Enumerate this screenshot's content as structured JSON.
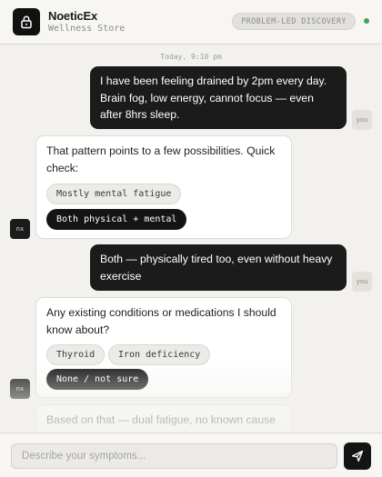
{
  "header": {
    "brand": "NoeticEx",
    "subtitle": "Wellness Store",
    "badge": "PROBLEM-LED DISCOVERY",
    "status_color": "#3fa45b"
  },
  "timestamp": "Today, 9:10 pm",
  "messages": [
    {
      "from": "you",
      "avatar": "you",
      "text": "I have been feeling drained by 2pm every day. Brain fog, low energy, cannot focus — even after 8hrs sleep."
    },
    {
      "from": "bot",
      "avatar": "nx",
      "text": "That pattern points to a few possibilities. Quick check:",
      "options": [
        "Mostly mental fatigue",
        "Both physical + mental"
      ],
      "selected": "Both physical + mental"
    },
    {
      "from": "you",
      "avatar": "you",
      "text": "Both — physically tired too, even without heavy exercise"
    },
    {
      "from": "bot",
      "avatar": "nx",
      "text": "Any existing conditions or medications I should know about?",
      "options": [
        "Thyroid",
        "Iron deficiency",
        "None / not sure"
      ],
      "selected": "None / not sure"
    },
    {
      "from": "bot",
      "avatar": "nx",
      "text": "Based on that — dual fatigue, no known cause"
    }
  ],
  "composer": {
    "placeholder": "Describe your symptoms...",
    "send_icon": "send-icon"
  },
  "colors": {
    "background": "#f2f1ee",
    "user_bubble": "#1b1b1b",
    "bot_bubble": "#ffffff",
    "accent": "#141414"
  }
}
